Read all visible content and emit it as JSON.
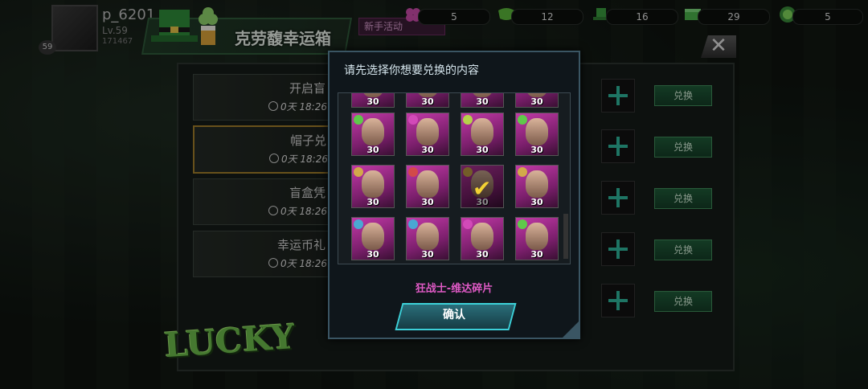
{
  "player": {
    "name": "p_6201",
    "level": "Lv.59",
    "id": "171467",
    "avatar_badge": "59"
  },
  "event": {
    "title": "克劳馥幸运箱",
    "newbie_tab": "新手活动"
  },
  "resources": [
    {
      "icon": "pink-clover-icon",
      "value": "5"
    },
    {
      "icon": "green-mask-icon",
      "value": "12"
    },
    {
      "icon": "green-hat-icon",
      "value": "16"
    },
    {
      "icon": "green-box-icon",
      "value": "29"
    },
    {
      "icon": "lucky-coin-icon",
      "value": "5"
    }
  ],
  "left_cards": [
    {
      "title": "开启盲",
      "time": "0天 18:26"
    },
    {
      "title": "帽子兑",
      "time": "0天 18:26"
    },
    {
      "title": "盲盒凭",
      "time": "0天 18:26"
    },
    {
      "title": "幸运币礼",
      "time": "0天 18:26"
    }
  ],
  "redeem_label": "兑换",
  "logo_text": "LUCKY",
  "dialog": {
    "title": "请先选择你想要兑换的内容",
    "selected_name": "狂战士-维达碎片",
    "confirm_label": "确认",
    "tiles": [
      {
        "count": "30",
        "badge": "#888888",
        "selected": false
      },
      {
        "count": "30",
        "badge": "#888888",
        "selected": false
      },
      {
        "count": "30",
        "badge": "#888888",
        "selected": false
      },
      {
        "count": "30",
        "badge": "#888888",
        "selected": false
      },
      {
        "count": "30",
        "badge": "#5fc94a",
        "selected": false
      },
      {
        "count": "30",
        "badge": "#d24ab8",
        "selected": false
      },
      {
        "count": "30",
        "badge": "#b6d24a",
        "selected": false
      },
      {
        "count": "30",
        "badge": "#5fc94a",
        "selected": false
      },
      {
        "count": "30",
        "badge": "#d2a94a",
        "selected": false
      },
      {
        "count": "30",
        "badge": "#d24a4a",
        "selected": false
      },
      {
        "count": "30",
        "badge": "#d2a94a",
        "selected": true
      },
      {
        "count": "30",
        "badge": "#d2a94a",
        "selected": false
      },
      {
        "count": "30",
        "badge": "#4aa8d2",
        "selected": false
      },
      {
        "count": "30",
        "badge": "#4aa8d2",
        "selected": false
      },
      {
        "count": "30",
        "badge": "#d24ab8",
        "selected": false
      },
      {
        "count": "30",
        "badge": "#5fc94a",
        "selected": false
      }
    ]
  }
}
